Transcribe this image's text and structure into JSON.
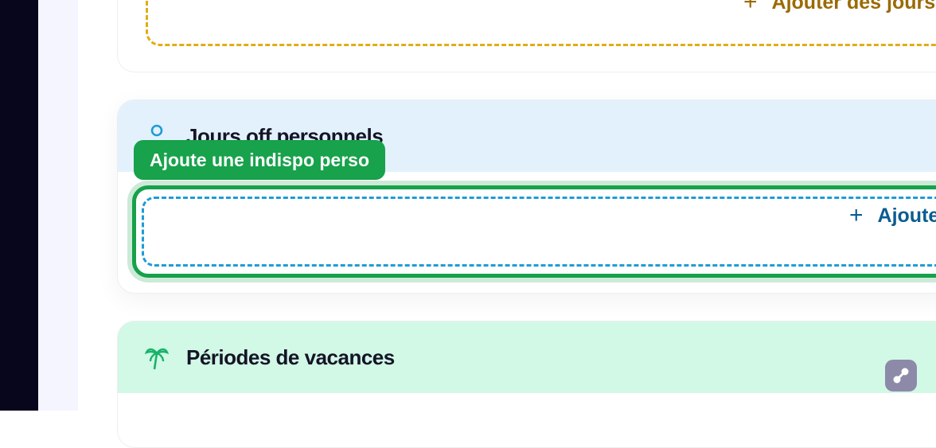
{
  "vacation_yellow": {
    "add_label": "Ajouter des jours"
  },
  "personal_days": {
    "title": "Jours off personnels",
    "add_label": "Ajouter"
  },
  "tooltip": {
    "text": "Ajoute une indispo perso"
  },
  "vacation_periods": {
    "title": "Périodes de vacances"
  },
  "icons": {
    "person": "person-icon",
    "palm": "palm-tree-icon",
    "plus": "plus-icon",
    "fab": "link-icon"
  },
  "colors": {
    "highlight": "#16a14a",
    "blue_dash": "#1e9cd6",
    "yellow_dash": "#e0ad14",
    "blue_header": "#e3f1fd",
    "green_header": "#d2f8e6"
  }
}
